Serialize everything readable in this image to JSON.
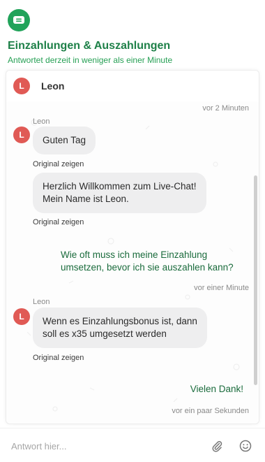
{
  "header": {
    "title": "Einzahlungen & Auszahlungen",
    "subtitle": "Antwortet derzeit in weniger als einer Minute",
    "logo_icon": "chat-bubble-icon",
    "brand_color": "#21a35a"
  },
  "agent": {
    "initial": "L",
    "name": "Leon",
    "avatar_color": "#e05a55"
  },
  "messages": {
    "time1": "vor 2 Minuten",
    "sender1": "Leon",
    "bubble1": "Guten Tag",
    "orig1": "Original zeigen",
    "bubble2_line1": "Herzlich Willkommen zum Live-Chat!",
    "bubble2_line2": "Mein Name ist Leon.",
    "orig2": "Original zeigen",
    "user1_line1": "Wie oft muss ich meine Einzahlung",
    "user1_line2": "umsetzen, bevor ich sie auszahlen kann?",
    "time2": "vor einer Minute",
    "sender2": "Leon",
    "bubble3_line1": "Wenn es Einzahlungsbonus ist, dann",
    "bubble3_line2": "soll es x35 umgesetzt werden",
    "orig3": "Original zeigen",
    "user2": "Vielen Dank!",
    "time3": "vor ein paar Sekunden"
  },
  "composer": {
    "placeholder": "Antwort hier...",
    "attach_icon": "paperclip-icon",
    "emoji_icon": "smiley-icon"
  }
}
